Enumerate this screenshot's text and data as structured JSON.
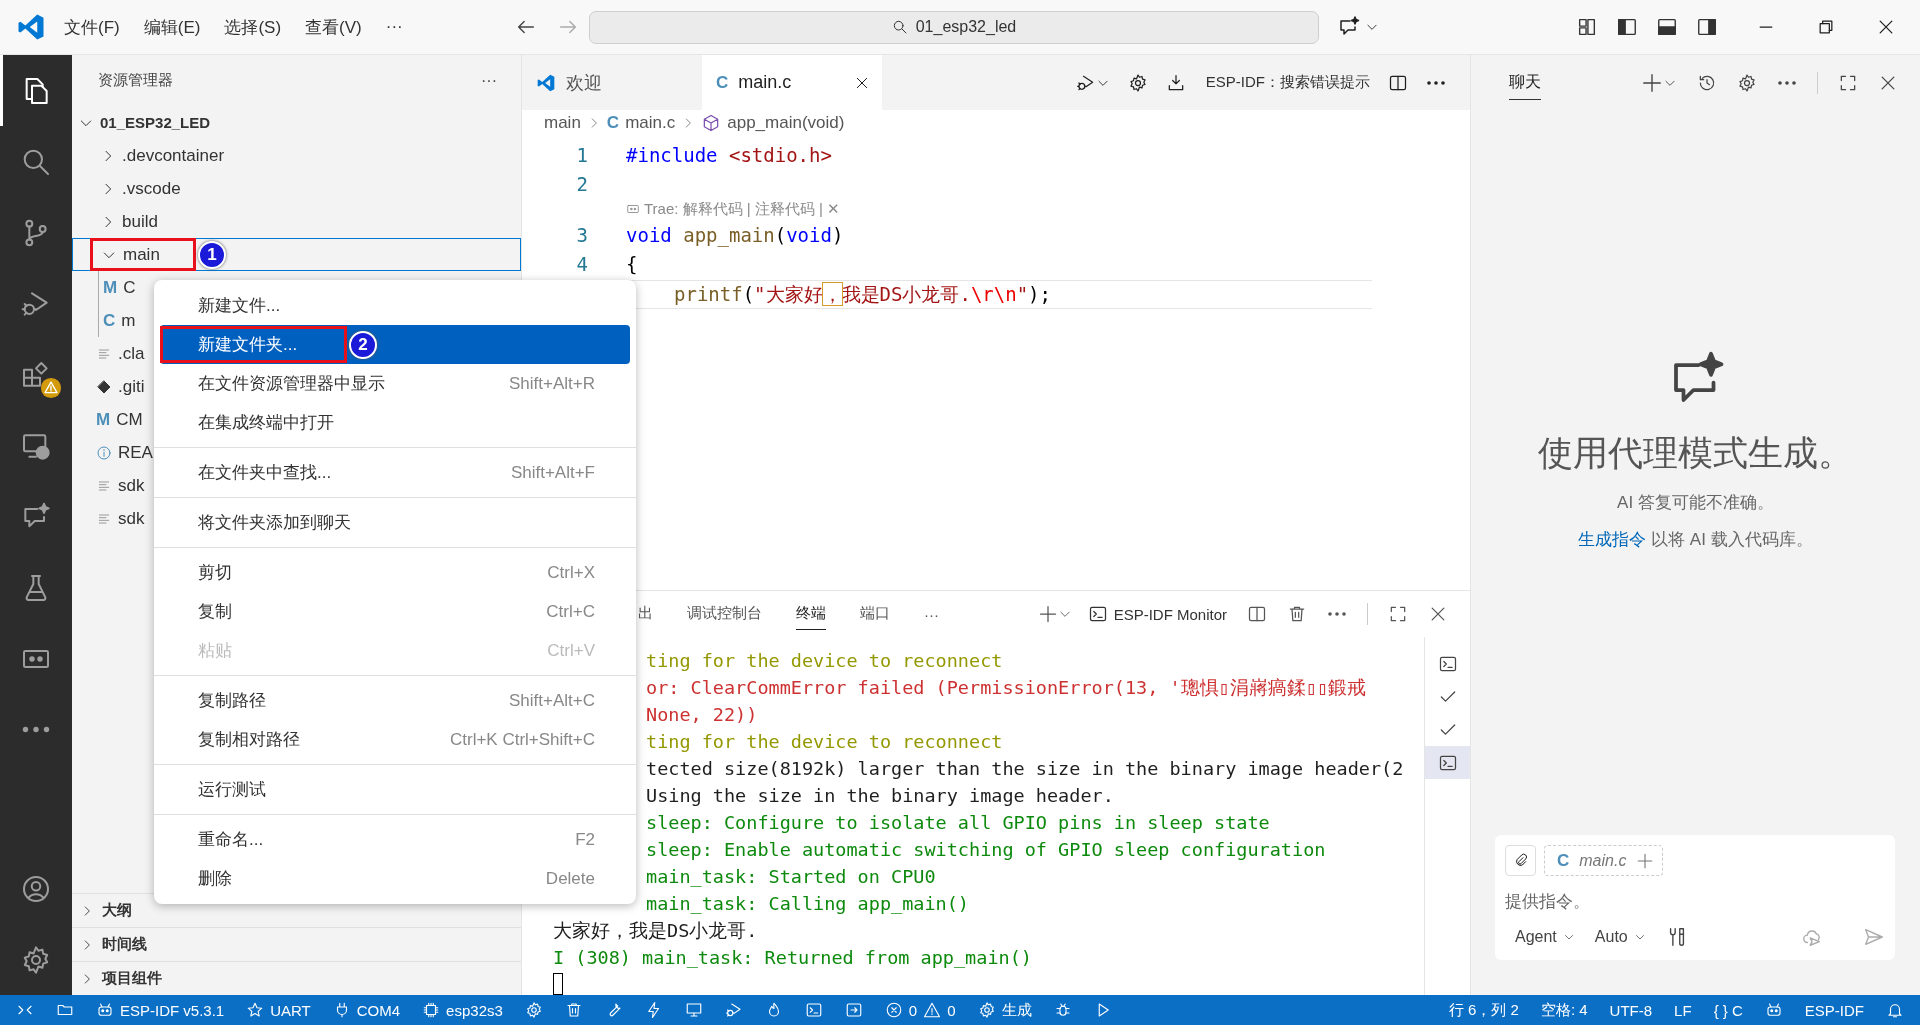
{
  "title_bar": {
    "menus": [
      {
        "label": "文件(F)"
      },
      {
        "label": "编辑(E)"
      },
      {
        "label": "选择(S)"
      },
      {
        "label": "查看(V)"
      },
      {
        "label": "···"
      }
    ],
    "search": "01_esp32_led"
  },
  "activity_bar": {
    "items": [
      {
        "selected": true
      },
      {
        "selected": false
      },
      {
        "selected": false
      },
      {
        "selected": false
      },
      {
        "selected": false
      },
      {
        "selected": false
      },
      {
        "selected": false
      },
      {
        "selected": false
      },
      {
        "selected": false
      },
      {
        "selected": false
      }
    ]
  },
  "sidebar": {
    "title": "资源管理器",
    "more": "···",
    "root": {
      "label": "01_ESP32_LED",
      "expanded": true
    },
    "tree": [
      {
        "label": ".devcontainer",
        "kind": "folder",
        "expanded": false,
        "selected": false
      },
      {
        "label": ".vscode",
        "kind": "folder",
        "expanded": false,
        "selected": false
      },
      {
        "label": "build",
        "kind": "folder",
        "expanded": false,
        "selected": false
      },
      {
        "label": "main",
        "kind": "folder",
        "expanded": true,
        "selected": true,
        "annotation": "1",
        "children": [
          {
            "label": "C",
            "kind": "glyph",
            "glyph": "M",
            "selected": false
          },
          {
            "label": "m",
            "kind": "glyph",
            "glyph": "C",
            "selected": false
          }
        ]
      },
      {
        "label": ".cla",
        "kind": "text",
        "selected": false
      },
      {
        "label": ".giti",
        "kind": "git",
        "selected": false
      },
      {
        "label": "CM",
        "kind": "glyph",
        "glyph": "M",
        "selected": false
      },
      {
        "label": "REA",
        "kind": "info",
        "selected": false
      },
      {
        "label": "sdk",
        "kind": "text",
        "selected": false
      },
      {
        "label": "sdk",
        "kind": "text",
        "selected": false
      }
    ],
    "sections": [
      {
        "label": "大纲",
        "expanded": false
      },
      {
        "label": "时间线",
        "expanded": false
      },
      {
        "label": "项目组件",
        "expanded": false
      }
    ]
  },
  "editor": {
    "tabs": [
      {
        "label": "欢迎",
        "selected": false
      },
      {
        "label": "main.c",
        "glyph": "C",
        "selected": true
      }
    ],
    "action": "ESP-IDF：搜索错误提示",
    "breadcrumb": [
      {
        "label": "main"
      },
      {
        "label": "main.c",
        "glyph": "C"
      },
      {
        "label": "app_main(void)"
      }
    ],
    "lines": [
      {
        "kind": "code",
        "number": "1",
        "current": false,
        "tokens": [
          {
            "text": "#include ",
            "kind": "kw"
          },
          {
            "text": "<stdio.h>",
            "kind": "str"
          }
        ]
      },
      {
        "kind": "code",
        "number": "2",
        "current": false
      },
      {
        "kind": "lens",
        "text": "Trae: 解释代码 | 注释代码 | ✕"
      },
      {
        "kind": "code",
        "number": "3",
        "current": false,
        "tokens": [
          {
            "text": "void ",
            "kind": "kw"
          },
          {
            "text": "app_main",
            "kind": "fn"
          },
          {
            "text": "(",
            "kind": "plain"
          },
          {
            "text": "void",
            "kind": "kw"
          },
          {
            "text": ")",
            "kind": "plain"
          }
        ]
      },
      {
        "kind": "code",
        "number": "4",
        "current": false,
        "tokens": [
          {
            "text": "{",
            "kind": "plain"
          }
        ]
      },
      {
        "kind": "body",
        "current": true,
        "tokens": [
          {
            "text": "printf",
            "kind": "fn"
          },
          {
            "text": "(",
            "kind": "plain"
          },
          {
            "text": "\"大家好",
            "kind": "str"
          },
          {
            "text": "，",
            "kind": "flag"
          },
          {
            "text": "我是DS小龙哥.",
            "kind": "str"
          },
          {
            "text": "\\r\\n",
            "kind": "esc"
          },
          {
            "text": "\"",
            "kind": "str"
          },
          {
            "text": ");",
            "kind": "plain"
          }
        ]
      }
    ]
  },
  "context_menu": {
    "groups": [
      {
        "items": [
          {
            "label": "新建文件...",
            "selected": false,
            "disabled": false
          },
          {
            "label": "新建文件夹...",
            "selected": true,
            "disabled": false,
            "annotation": "2"
          },
          {
            "label": "在文件资源管理器中显示",
            "shortcut": "Shift+Alt+R",
            "selected": false,
            "disabled": false
          },
          {
            "label": "在集成终端中打开",
            "selected": false,
            "disabled": false
          }
        ]
      },
      {
        "items": [
          {
            "label": "在文件夹中查找...",
            "shortcut": "Shift+Alt+F",
            "selected": false,
            "disabled": false
          }
        ]
      },
      {
        "items": [
          {
            "label": "将文件夹添加到聊天",
            "selected": false,
            "disabled": false
          }
        ]
      },
      {
        "items": [
          {
            "label": "剪切",
            "shortcut": "Ctrl+X",
            "selected": false,
            "disabled": false
          },
          {
            "label": "复制",
            "shortcut": "Ctrl+C",
            "selected": false,
            "disabled": false
          },
          {
            "label": "粘贴",
            "shortcut": "Ctrl+V",
            "selected": false,
            "disabled": true
          }
        ]
      },
      {
        "items": [
          {
            "label": "复制路径",
            "shortcut": "Shift+Alt+C",
            "selected": false,
            "disabled": false
          },
          {
            "label": "复制相对路径",
            "shortcut": "Ctrl+K Ctrl+Shift+C",
            "selected": false,
            "disabled": false
          }
        ]
      },
      {
        "items": [
          {
            "label": "运行测试",
            "selected": false,
            "disabled": false
          }
        ]
      },
      {
        "items": [
          {
            "label": "重命名...",
            "shortcut": "F2",
            "selected": false,
            "disabled": false
          },
          {
            "label": "删除",
            "shortcut": "Delete",
            "selected": false,
            "disabled": false
          }
        ]
      }
    ]
  },
  "panel": {
    "tabs": [
      {
        "label": "出",
        "selected": false
      },
      {
        "label": "调试控制台",
        "selected": false
      },
      {
        "label": "终端",
        "selected": true
      },
      {
        "label": "端口",
        "selected": false
      }
    ],
    "more": "···",
    "terminal_name": "ESP-IDF Monitor",
    "lines": [
      {
        "text": "ting for the device to reconnect",
        "kind": "warn"
      },
      {
        "text": "or: ClearCommError failed (PermissionError(13, '璁惧▯涓嶈瘑鍒▯▯鍛戒",
        "kind": "error"
      },
      {
        "text": "None, 22))",
        "kind": "error"
      },
      {
        "text": "ting for the device to reconnect",
        "kind": "warn"
      },
      {
        "text": "tected size(8192k) larger than the size in the binary image header(2",
        "kind": "plain"
      },
      {
        "text": "Using the size in the binary image header.",
        "kind": "plain"
      },
      {
        "text": "sleep: Configure to isolate all GPIO pins in sleep state",
        "kind": "info"
      },
      {
        "text": "sleep: Enable automatic switching of GPIO sleep configuration",
        "kind": "info"
      },
      {
        "text": "main_task: Started on CPU0",
        "kind": "info"
      },
      {
        "text": "main_task: Calling app_main()",
        "kind": "info"
      },
      {
        "text": "大家好，我是DS小龙哥.",
        "kind": "plain"
      },
      {
        "text": "I (308) main_task: Returned from app_main()",
        "kind": "info"
      }
    ],
    "terminals": [
      {
        "kind": "shell",
        "selected": false
      },
      {
        "kind": "task",
        "selected": false
      },
      {
        "kind": "task",
        "selected": false
      },
      {
        "kind": "shell",
        "selected": true
      }
    ]
  },
  "chat": {
    "tab": "聊天",
    "title": "使用代理模式生成。",
    "subtitle": "AI 答复可能不准确。",
    "link": "生成指令",
    "link_tail": " 以将 AI 载入代码库。",
    "input": {
      "chip_glyph": "C",
      "chip": "main.c",
      "placeholder": "提供指令。",
      "mode": "Agent",
      "model": "Auto"
    }
  },
  "status_bar": {
    "left": [
      {
        "label": "ESP-IDF v5.3.1"
      },
      {
        "label": "UART"
      },
      {
        "label": "COM4"
      },
      {
        "label": "esp32s3"
      }
    ],
    "errors": "0",
    "warnings": "0",
    "build": "生成",
    "right": [
      {
        "label": "行 6，列 2"
      },
      {
        "label": "空格: 4"
      },
      {
        "label": "UTF-8"
      },
      {
        "label": "LF"
      },
      {
        "label": "{ } C"
      }
    ],
    "idf": "ESP-IDF"
  }
}
